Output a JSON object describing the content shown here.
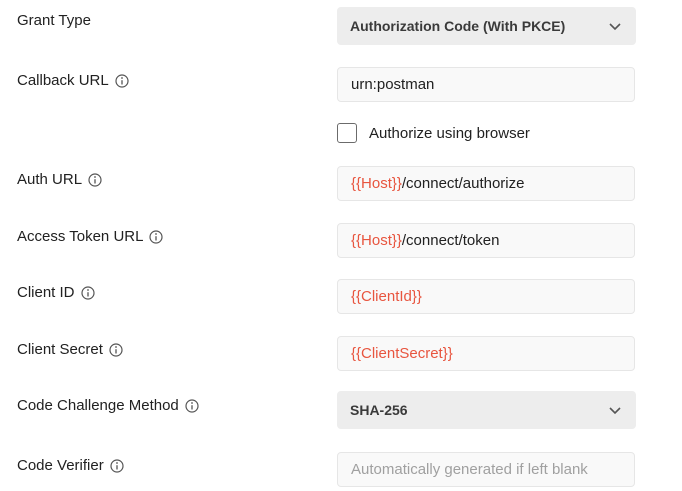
{
  "grant_type": {
    "label": "Grant Type",
    "value": "Authorization Code (With PKCE)"
  },
  "callback_url": {
    "label": "Callback URL",
    "value": "urn:postman"
  },
  "authorize_browser": {
    "label": "Authorize using browser",
    "checked": false
  },
  "auth_url": {
    "label": "Auth URL",
    "var": "{{Host}}",
    "rest": "/connect/authorize"
  },
  "access_token_url": {
    "label": "Access Token URL",
    "var": "{{Host}}",
    "rest": "/connect/token"
  },
  "client_id": {
    "label": "Client ID",
    "var": "{{ClientId}}"
  },
  "client_secret": {
    "label": "Client Secret",
    "var": "{{ClientSecret}}"
  },
  "code_challenge_method": {
    "label": "Code Challenge Method",
    "value": "SHA-256"
  },
  "code_verifier": {
    "label": "Code Verifier",
    "placeholder": "Automatically generated if left blank"
  },
  "colors": {
    "variable": "#e8553f",
    "select_bg": "#ededed",
    "field_bg": "#f9f9f9"
  },
  "icons": {
    "info": "info-icon",
    "chevron": "chevron-down-icon"
  }
}
